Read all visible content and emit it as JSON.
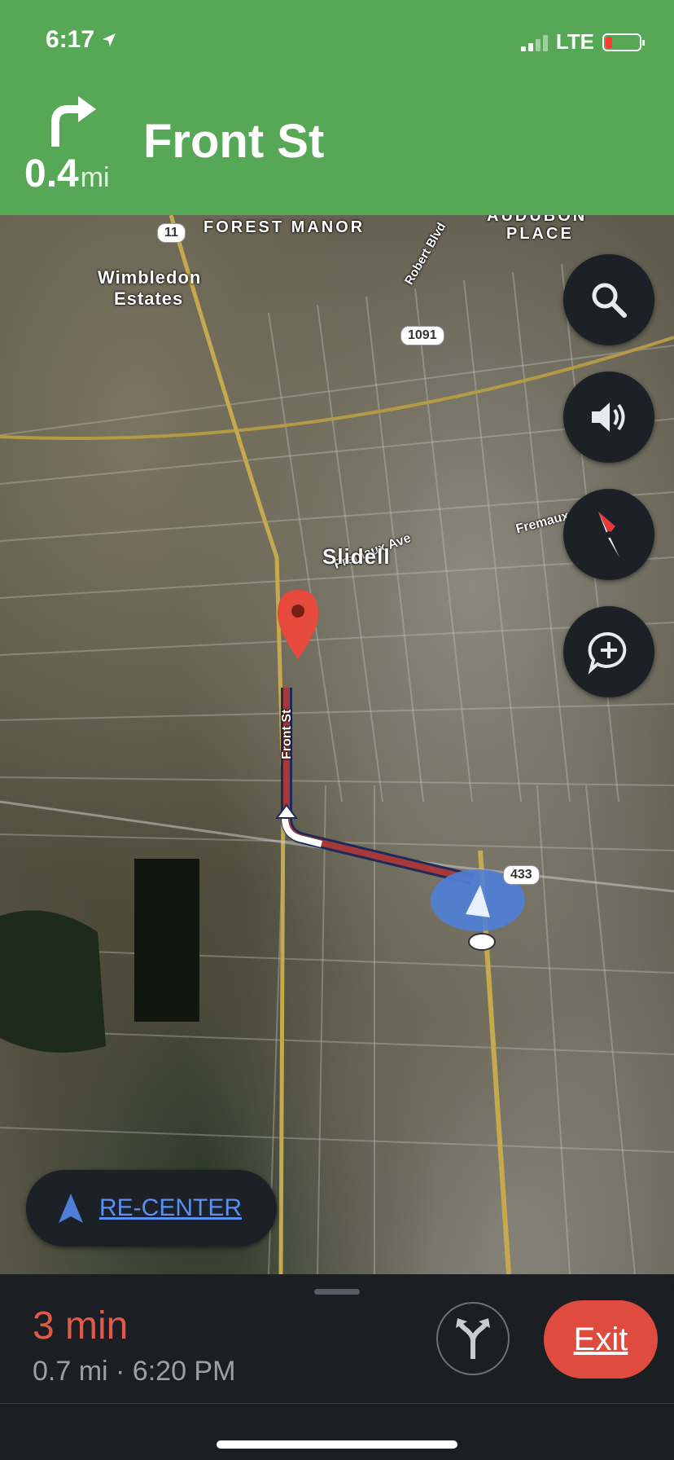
{
  "status": {
    "time": "6:17",
    "carrier": "LTE"
  },
  "instruction": {
    "distance": "0.4",
    "unit": "mi",
    "street": "Front St",
    "icon": "turn-right-icon"
  },
  "map": {
    "labels": {
      "forest_manor": "FOREST MANOR",
      "audubon_1": "AUDUBON",
      "audubon_2": "PLACE",
      "wimbledon_1": "Wimbledon",
      "wimbledon_2": "Estates",
      "robert_blvd": "Robert Blvd",
      "fremaux_ave": "Fremaux Ave",
      "fremaux_right": "Fremaux",
      "slidell": "Slidell",
      "front_st": "Front St"
    },
    "shields": {
      "hwy11": "11",
      "hwy1091": "1091",
      "hwy433": "433"
    },
    "buttons": [
      "search-icon",
      "volume-icon",
      "compass-icon",
      "add-report-icon"
    ]
  },
  "recenter": {
    "label": "RE-CENTER"
  },
  "trip": {
    "time": "3 min",
    "detail": "0.7 mi · 6:20 PM",
    "exit_label": "Exit"
  },
  "colors": {
    "header": "#56a756",
    "eta": "#e05a4b",
    "exit": "#e04b3f",
    "recenter": "#5b8ff2"
  }
}
